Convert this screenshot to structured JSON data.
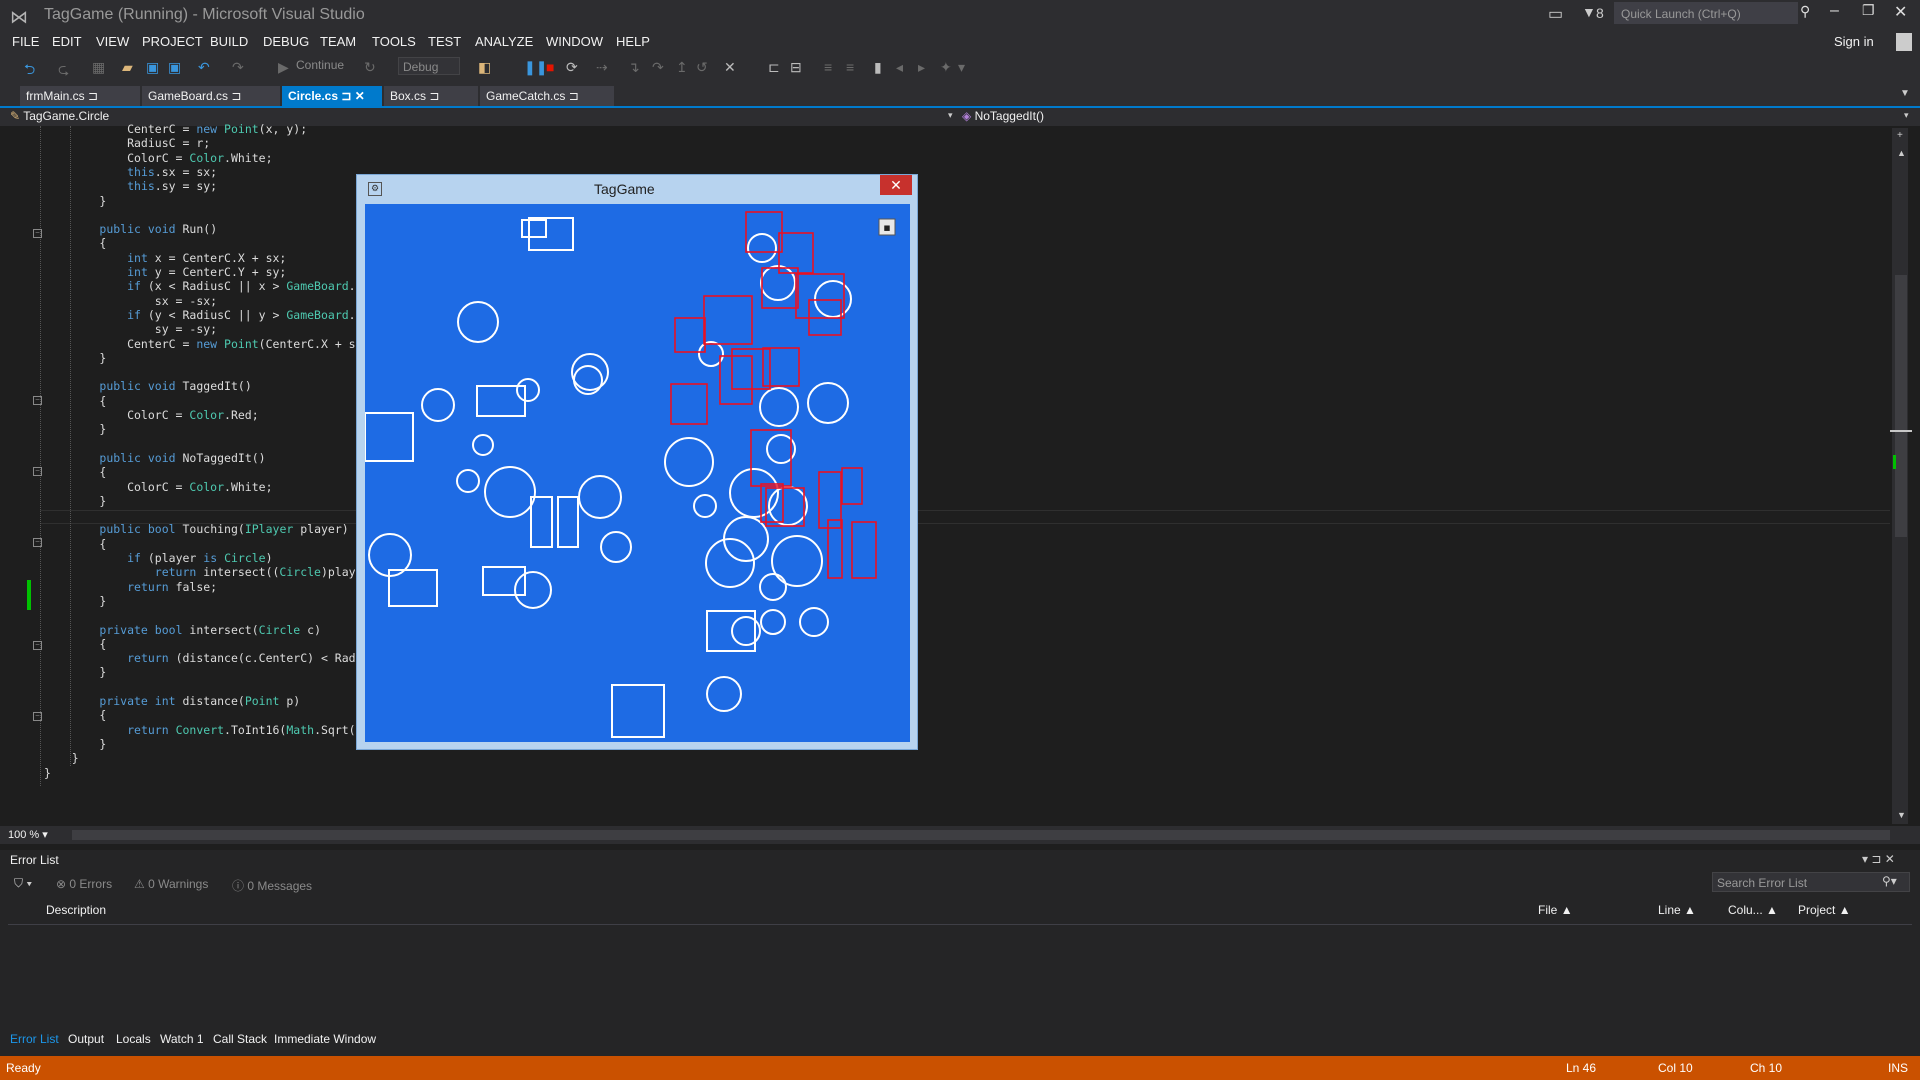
{
  "window": {
    "title": "TagGame (Running) - Microsoft Visual Studio",
    "notification_count": "8",
    "quick_launch_placeholder": "Quick Launch (Ctrl+Q)",
    "sign_in": "Sign in"
  },
  "menu": [
    "FILE",
    "EDIT",
    "VIEW",
    "PROJECT",
    "BUILD",
    "DEBUG",
    "TEAM",
    "TOOLS",
    "TEST",
    "ANALYZE",
    "WINDOW",
    "HELP"
  ],
  "toolbar": {
    "continue_label": "Continue",
    "config_label": "Debug"
  },
  "tabs": [
    {
      "label": "frmMain.cs",
      "active": false
    },
    {
      "label": "GameBoard.cs",
      "active": false
    },
    {
      "label": "Circle.cs",
      "active": true
    },
    {
      "label": "Box.cs",
      "active": false
    },
    {
      "label": "GameCatch.cs",
      "active": false
    }
  ],
  "navbar": {
    "class_label": "TagGame.Circle",
    "member_label": "NoTaggedIt()"
  },
  "code_lines": [
    "            CenterC = new Point(x, y);",
    "            RadiusC = r;",
    "            ColorC = Color.White;",
    "            this.sx = sx;",
    "            this.sy = sy;",
    "        }",
    "",
    "        public void Run()",
    "        {",
    "            int x = CenterC.X + sx;",
    "            int y = CenterC.Y + sy;",
    "            if (x < RadiusC || x > GameBoard.",
    "                sx = -sx;",
    "            if (y < RadiusC || y > GameBoard.",
    "                sy = -sy;",
    "            CenterC = new Point(CenterC.X + s",
    "        }",
    "",
    "        public void TaggedIt()",
    "        {",
    "            ColorC = Color.Red;",
    "        }",
    "",
    "        public void NoTaggedIt()",
    "        {",
    "            ColorC = Color.White;",
    "        }",
    "",
    "        public bool Touching(IPlayer player)",
    "        {",
    "            if (player is Circle)",
    "                return intersect((Circle)play",
    "            return false;",
    "        }",
    "",
    "        private bool intersect(Circle c)",
    "        {",
    "            return (distance(c.CenterC) < Rad",
    "        }",
    "",
    "        private int distance(Point p)",
    "        {",
    "            return Convert.ToInt16(Math.Sqrt(",
    "        }",
    "    }",
    "}"
  ],
  "zoom": "100 %",
  "error_list": {
    "title": "Error List",
    "errors": "0 Errors",
    "warnings": "0 Warnings",
    "messages": "0 Messages",
    "search_placeholder": "Search Error List",
    "columns": [
      "Description",
      "File",
      "Line",
      "Colu...",
      "Project"
    ]
  },
  "bottom_tabs": [
    {
      "label": "Error List",
      "active": true
    },
    {
      "label": "Output",
      "active": false
    },
    {
      "label": "Locals",
      "active": false
    },
    {
      "label": "Watch 1",
      "active": false
    },
    {
      "label": "Call Stack",
      "active": false
    },
    {
      "label": "Immediate Window",
      "active": false
    }
  ],
  "status": {
    "ready": "Ready",
    "line": "Ln 46",
    "col": "Col 10",
    "ch": "Ch 10",
    "mode": "INS"
  },
  "tag_game": {
    "title": "TagGame",
    "close_label": "✕",
    "board_color": "#1e6be4",
    "white_color": "#ffffff",
    "tagged_color": "#e81123"
  },
  "colors": {
    "accent": "#007acc",
    "status_bar": "#ca5100"
  }
}
